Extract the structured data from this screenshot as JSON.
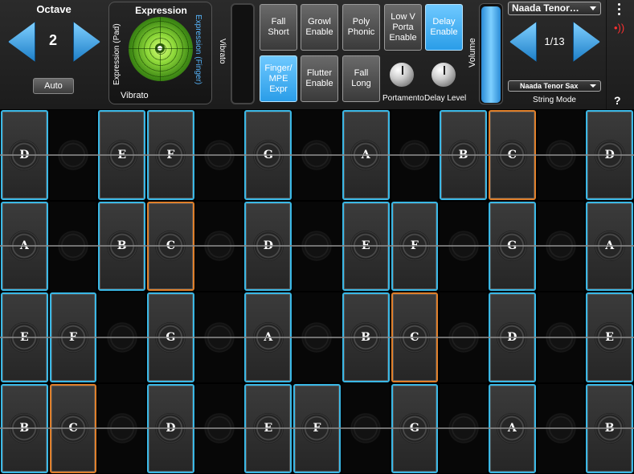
{
  "octave": {
    "title": "Octave",
    "value": "2",
    "auto_label": "Auto"
  },
  "expression": {
    "title": "Expression",
    "pad_label": "Expression (Pad)",
    "finger_label": "Expression (Finger)",
    "vibrato_label": "Vibrato"
  },
  "vibrato_strip": {
    "label": "Vibrato"
  },
  "buttons": [
    {
      "label": "Fall\nShort",
      "active": false
    },
    {
      "label": "Growl\nEnable",
      "active": false
    },
    {
      "label": "Poly\nPhonic",
      "active": false
    },
    {
      "label": "Low V\nPorta\nEnable",
      "active": false
    },
    {
      "label": "Delay\nEnable",
      "active": true
    },
    {
      "label": "Finger/\nMPE\nExpr",
      "active": true
    },
    {
      "label": "Flutter\nEnable",
      "active": false
    },
    {
      "label": "Fall\nLong",
      "active": false
    }
  ],
  "knobs": {
    "portamento": "Portamento",
    "delay_level": "Delay Level"
  },
  "volume": {
    "label": "Volume",
    "level": 1.0
  },
  "preset": {
    "name": "Naada Tenor…",
    "count": "1/13",
    "sub_name": "Naada Tenor Sax",
    "mode_label": "String Mode"
  },
  "icons": {
    "menu": "more-vertical-icon",
    "midi": "wireless-signal-icon",
    "help": "help-icon"
  },
  "colors": {
    "accent_blue": "#3ab8e6",
    "root_orange": "#e07f2a",
    "active_button": "#2a9de8"
  },
  "grid": {
    "rows": [
      [
        "D",
        "",
        "E",
        "F",
        "",
        "G",
        "",
        "A",
        "",
        "B",
        "C",
        "",
        "D"
      ],
      [
        "A",
        "",
        "B",
        "C",
        "",
        "D",
        "",
        "E",
        "F",
        "",
        "G",
        "",
        "A"
      ],
      [
        "E",
        "F",
        "",
        "G",
        "",
        "A",
        "",
        "B",
        "C",
        "",
        "D",
        "",
        "E"
      ],
      [
        "B",
        "C",
        "",
        "D",
        "",
        "E",
        "F",
        "",
        "G",
        "",
        "A",
        "",
        "B"
      ]
    ],
    "root_note": "C"
  }
}
